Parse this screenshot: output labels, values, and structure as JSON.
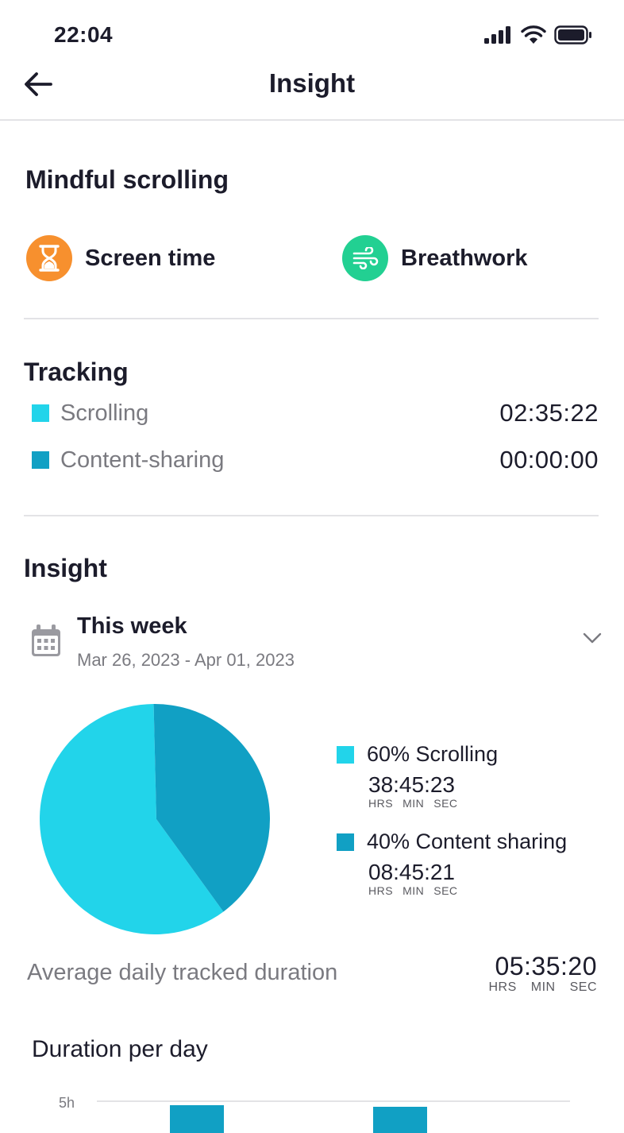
{
  "status": {
    "time": "22:04"
  },
  "header": {
    "title": "Insight",
    "back_icon": "arrow-left-icon"
  },
  "mindful": {
    "title": "Mindful scrolling",
    "shortcuts": [
      {
        "label": "Screen time",
        "icon": "hourglass-icon",
        "color": "#F7902E"
      },
      {
        "label": "Breathwork",
        "icon": "wind-icon",
        "color": "#22D092"
      }
    ]
  },
  "tracking": {
    "title": "Tracking",
    "rows": [
      {
        "label": "Scrolling",
        "value": "02:35:22",
        "color": "#22D4EA"
      },
      {
        "label": "Content-sharing",
        "value": "00:00:00",
        "color": "#11A0C4"
      }
    ]
  },
  "insight": {
    "title": "Insight",
    "period": {
      "title": "This week",
      "dates": "Mar 26, 2023 - Apr 01, 2023"
    },
    "units": {
      "hrs": "HRS",
      "min": "MIN",
      "sec": "SEC"
    },
    "legend": [
      {
        "label": "60% Scrolling",
        "time": "38:45:23",
        "color": "#22D4EA"
      },
      {
        "label": "40% Content sharing",
        "time": "08:45:21",
        "color": "#11A0C4"
      }
    ],
    "average": {
      "label": "Average daily tracked duration",
      "time": "05:35:20"
    },
    "duration_title": "Duration per day"
  },
  "chart_data": [
    {
      "type": "pie",
      "slices": [
        {
          "label": "60% Scrolling",
          "value": 60,
          "color": "#22D4EA"
        },
        {
          "label": "40% Content sharing",
          "value": 40,
          "color": "#11A0C4"
        }
      ]
    },
    {
      "type": "bar",
      "title": "Duration per day",
      "y_tick_labels": [
        "5h"
      ],
      "bars_visible": 2,
      "color": "#11A0C4"
    }
  ]
}
